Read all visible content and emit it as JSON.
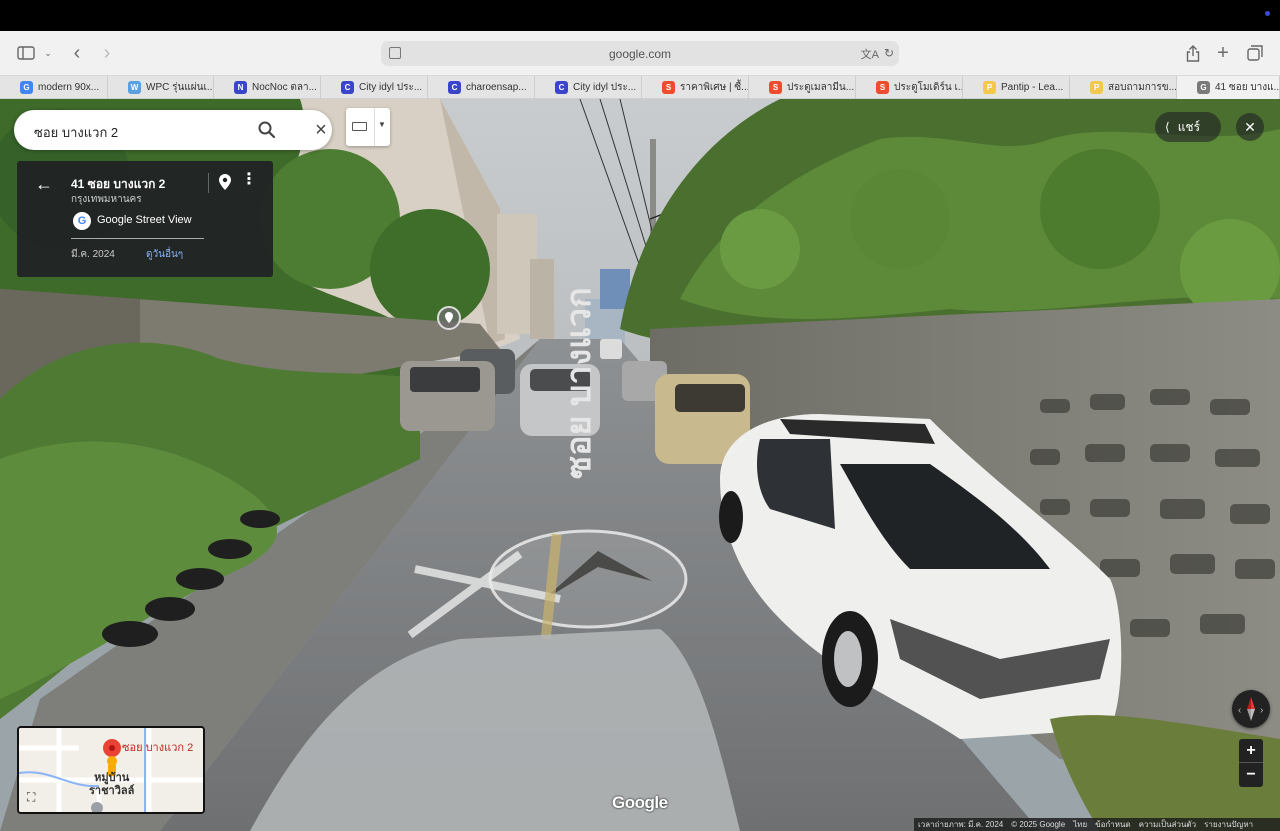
{
  "browser": {
    "url": "google.com",
    "tabs": [
      {
        "label": "modern 90x...",
        "fav": "G",
        "color": "#4285f4"
      },
      {
        "label": "WPC รุ่นแผ่นเ...",
        "fav": "W",
        "color": "#5aa0e0"
      },
      {
        "label": "NocNoc ตลา...",
        "fav": "N",
        "color": "#3a45c9"
      },
      {
        "label": "City idyl ประ...",
        "fav": "C",
        "color": "#3a45c9"
      },
      {
        "label": "charoensap...",
        "fav": "C",
        "color": "#3a45c9"
      },
      {
        "label": "City idyl ประ...",
        "fav": "C",
        "color": "#3a45c9"
      },
      {
        "label": "ราคาพิเศษ | ซื้...",
        "fav": "S",
        "color": "#ee4d2d"
      },
      {
        "label": "ประตูเมลามีน...",
        "fav": "S",
        "color": "#ee4d2d"
      },
      {
        "label": "ประตูโมเดิร์น เ...",
        "fav": "S",
        "color": "#ee4d2d"
      },
      {
        "label": "Pantip - Lea...",
        "fav": "P",
        "color": "#f2c94c"
      },
      {
        "label": "สอบถามการข...",
        "fav": "P",
        "color": "#f2c94c"
      },
      {
        "label": "41 ซอย บางแ...",
        "fav": "G",
        "color": "#7a7a7a"
      }
    ]
  },
  "search": {
    "query": "ซอย บางแวก 2"
  },
  "card": {
    "title": "41 ซอย บางแวก 2",
    "subtitle": "กรุงเทพมหานคร",
    "source": "Google Street View",
    "date": "มี.ค. 2024",
    "other_dates": "ดูวันอื่นๆ"
  },
  "share": {
    "label": "แชร์"
  },
  "minimap": {
    "pin_label": "ซอย บางแวก 2",
    "place_label_1": "หมู่บ้าน",
    "place_label_2": "ราชาวิลล์"
  },
  "logo": "Google",
  "footer": {
    "image_date": "เวลาถ่ายภาพ: มี.ค. 2024",
    "copyright": "© 2025 Google",
    "lang": "ไทย",
    "terms": "ข้อกำหนด",
    "privacy": "ความเป็นส่วนตัว",
    "report": "รายงานปัญหา"
  },
  "road_marking": "ซอย บางแวก"
}
